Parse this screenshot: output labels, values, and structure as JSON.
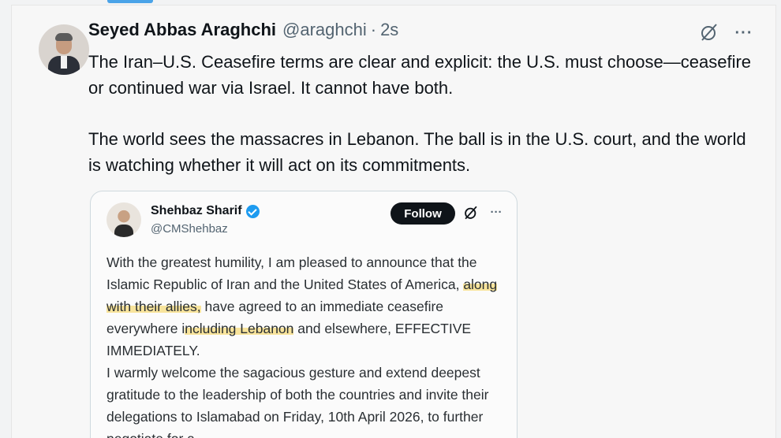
{
  "tweet": {
    "author_name": "Seyed Abbas Araghchi",
    "author_handle": "@araghchi",
    "separator": "·",
    "time": "2s",
    "more_label": "···",
    "paragraph1": "The Iran–U.S. Ceasefire terms are clear and explicit: the U.S. must choose—ceasefire or continued war via Israel. It cannot have both.",
    "paragraph2": "The world sees the massacres in Lebanon. The ball is in the U.S. court, and the world is watching whether it will act on its commitments."
  },
  "quoted": {
    "author_name": "Shehbaz Sharif",
    "author_handle": "@CMShehbaz",
    "follow_label": "Follow",
    "more_label": "···",
    "text_1a": "With the greatest humility, I am pleased to announce that the Islamic Republic of Iran and the United States of America, ",
    "text_1b_highlight": "along with their allies,",
    "text_1c": " have agreed to an immediate ceasefire everywhere i",
    "text_1d_highlight": "ncluding Lebanon",
    "text_1e": " and elsewhere, EFFECTIVE IMMEDIATELY.",
    "text_2": "I warmly welcome the sagacious gesture and extend deepest gratitude to the leadership of both the countries and invite their delegations to Islamabad on Friday, 10th April 2026, to further negotiate for a"
  },
  "colors": {
    "accent": "#1d9bf0",
    "highlight": "#f8e49c",
    "follow_bg": "#0f1419"
  },
  "icons": {
    "grok": "grok-slash-circle-icon",
    "more": "more-horizontal-icon",
    "verified": "verified-badge-icon"
  }
}
